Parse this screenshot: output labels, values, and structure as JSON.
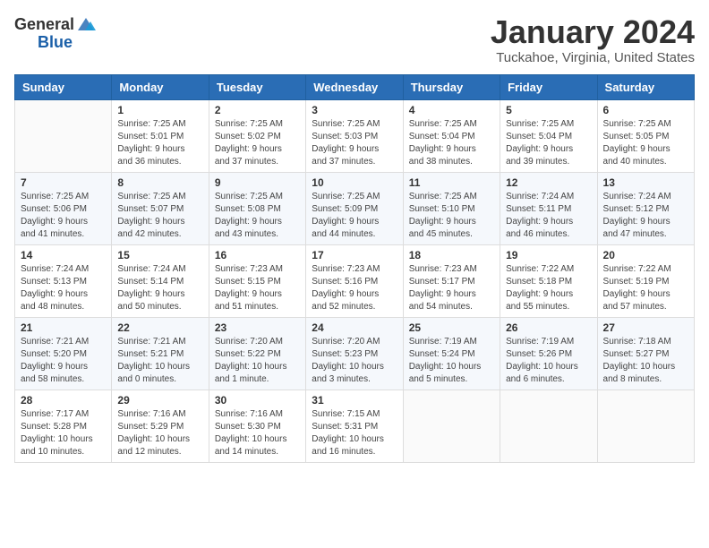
{
  "logo": {
    "general": "General",
    "blue": "Blue"
  },
  "header": {
    "month": "January 2024",
    "location": "Tuckahoe, Virginia, United States"
  },
  "days_of_week": [
    "Sunday",
    "Monday",
    "Tuesday",
    "Wednesday",
    "Thursday",
    "Friday",
    "Saturday"
  ],
  "weeks": [
    [
      {
        "day": "",
        "info": ""
      },
      {
        "day": "1",
        "info": "Sunrise: 7:25 AM\nSunset: 5:01 PM\nDaylight: 9 hours\nand 36 minutes."
      },
      {
        "day": "2",
        "info": "Sunrise: 7:25 AM\nSunset: 5:02 PM\nDaylight: 9 hours\nand 37 minutes."
      },
      {
        "day": "3",
        "info": "Sunrise: 7:25 AM\nSunset: 5:03 PM\nDaylight: 9 hours\nand 37 minutes."
      },
      {
        "day": "4",
        "info": "Sunrise: 7:25 AM\nSunset: 5:04 PM\nDaylight: 9 hours\nand 38 minutes."
      },
      {
        "day": "5",
        "info": "Sunrise: 7:25 AM\nSunset: 5:04 PM\nDaylight: 9 hours\nand 39 minutes."
      },
      {
        "day": "6",
        "info": "Sunrise: 7:25 AM\nSunset: 5:05 PM\nDaylight: 9 hours\nand 40 minutes."
      }
    ],
    [
      {
        "day": "7",
        "info": "Sunrise: 7:25 AM\nSunset: 5:06 PM\nDaylight: 9 hours\nand 41 minutes."
      },
      {
        "day": "8",
        "info": "Sunrise: 7:25 AM\nSunset: 5:07 PM\nDaylight: 9 hours\nand 42 minutes."
      },
      {
        "day": "9",
        "info": "Sunrise: 7:25 AM\nSunset: 5:08 PM\nDaylight: 9 hours\nand 43 minutes."
      },
      {
        "day": "10",
        "info": "Sunrise: 7:25 AM\nSunset: 5:09 PM\nDaylight: 9 hours\nand 44 minutes."
      },
      {
        "day": "11",
        "info": "Sunrise: 7:25 AM\nSunset: 5:10 PM\nDaylight: 9 hours\nand 45 minutes."
      },
      {
        "day": "12",
        "info": "Sunrise: 7:24 AM\nSunset: 5:11 PM\nDaylight: 9 hours\nand 46 minutes."
      },
      {
        "day": "13",
        "info": "Sunrise: 7:24 AM\nSunset: 5:12 PM\nDaylight: 9 hours\nand 47 minutes."
      }
    ],
    [
      {
        "day": "14",
        "info": "Sunrise: 7:24 AM\nSunset: 5:13 PM\nDaylight: 9 hours\nand 48 minutes."
      },
      {
        "day": "15",
        "info": "Sunrise: 7:24 AM\nSunset: 5:14 PM\nDaylight: 9 hours\nand 50 minutes."
      },
      {
        "day": "16",
        "info": "Sunrise: 7:23 AM\nSunset: 5:15 PM\nDaylight: 9 hours\nand 51 minutes."
      },
      {
        "day": "17",
        "info": "Sunrise: 7:23 AM\nSunset: 5:16 PM\nDaylight: 9 hours\nand 52 minutes."
      },
      {
        "day": "18",
        "info": "Sunrise: 7:23 AM\nSunset: 5:17 PM\nDaylight: 9 hours\nand 54 minutes."
      },
      {
        "day": "19",
        "info": "Sunrise: 7:22 AM\nSunset: 5:18 PM\nDaylight: 9 hours\nand 55 minutes."
      },
      {
        "day": "20",
        "info": "Sunrise: 7:22 AM\nSunset: 5:19 PM\nDaylight: 9 hours\nand 57 minutes."
      }
    ],
    [
      {
        "day": "21",
        "info": "Sunrise: 7:21 AM\nSunset: 5:20 PM\nDaylight: 9 hours\nand 58 minutes."
      },
      {
        "day": "22",
        "info": "Sunrise: 7:21 AM\nSunset: 5:21 PM\nDaylight: 10 hours\nand 0 minutes."
      },
      {
        "day": "23",
        "info": "Sunrise: 7:20 AM\nSunset: 5:22 PM\nDaylight: 10 hours\nand 1 minute."
      },
      {
        "day": "24",
        "info": "Sunrise: 7:20 AM\nSunset: 5:23 PM\nDaylight: 10 hours\nand 3 minutes."
      },
      {
        "day": "25",
        "info": "Sunrise: 7:19 AM\nSunset: 5:24 PM\nDaylight: 10 hours\nand 5 minutes."
      },
      {
        "day": "26",
        "info": "Sunrise: 7:19 AM\nSunset: 5:26 PM\nDaylight: 10 hours\nand 6 minutes."
      },
      {
        "day": "27",
        "info": "Sunrise: 7:18 AM\nSunset: 5:27 PM\nDaylight: 10 hours\nand 8 minutes."
      }
    ],
    [
      {
        "day": "28",
        "info": "Sunrise: 7:17 AM\nSunset: 5:28 PM\nDaylight: 10 hours\nand 10 minutes."
      },
      {
        "day": "29",
        "info": "Sunrise: 7:16 AM\nSunset: 5:29 PM\nDaylight: 10 hours\nand 12 minutes."
      },
      {
        "day": "30",
        "info": "Sunrise: 7:16 AM\nSunset: 5:30 PM\nDaylight: 10 hours\nand 14 minutes."
      },
      {
        "day": "31",
        "info": "Sunrise: 7:15 AM\nSunset: 5:31 PM\nDaylight: 10 hours\nand 16 minutes."
      },
      {
        "day": "",
        "info": ""
      },
      {
        "day": "",
        "info": ""
      },
      {
        "day": "",
        "info": ""
      }
    ]
  ]
}
